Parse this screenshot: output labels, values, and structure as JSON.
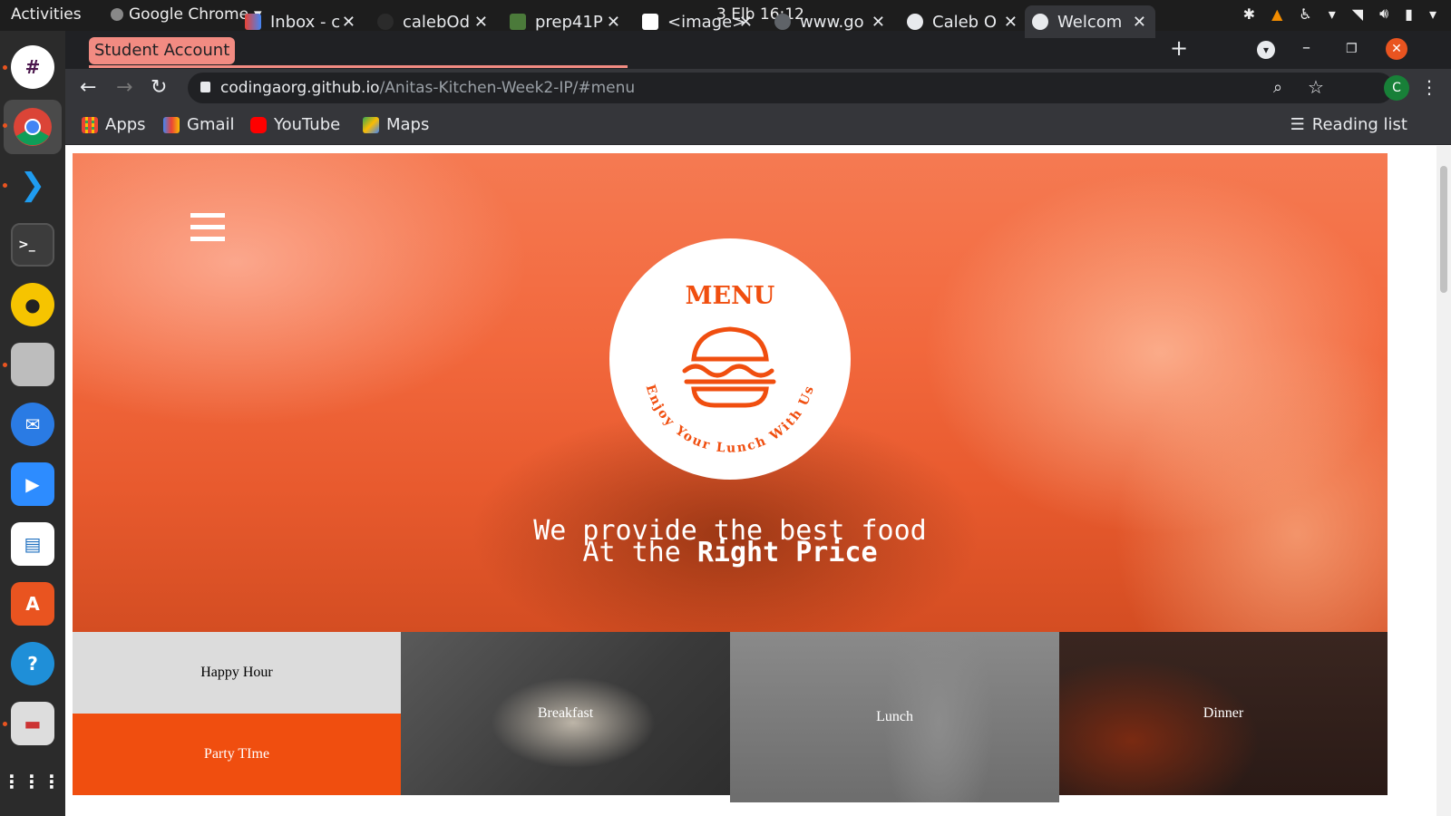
{
  "system": {
    "activities_label": "Activities",
    "app_name": "Google Chrome",
    "clock": "3 Elb  16:12"
  },
  "browser": {
    "tab_group_label": "Student Account",
    "tabs": [
      {
        "label": "Inbox - c"
      },
      {
        "label": "calebOd"
      },
      {
        "label": "prep41P"
      },
      {
        "label": "<image>"
      },
      {
        "label": "www.go"
      },
      {
        "label": "Caleb O"
      },
      {
        "label": "Welcom"
      }
    ],
    "new_tab_label": "+",
    "url_host": "codingaorg.github.io",
    "url_path": "/Anitas-Kitchen-Week2-IP/#menu",
    "profile_initial": "C",
    "bookmarks": [
      {
        "label": "Apps",
        "icon": "apps-grid-icon"
      },
      {
        "label": "Gmail",
        "icon": "gmail-icon"
      },
      {
        "label": "YouTube",
        "icon": "youtube-icon"
      },
      {
        "label": "Maps",
        "icon": "maps-icon"
      }
    ],
    "reading_list_label": "Reading list"
  },
  "page": {
    "badge_title": "MENU",
    "badge_arc_text": "Enjoy Your Lunch With Us",
    "tagline_line1": "We provide the best food",
    "tagline_line2_prefix": "At the ",
    "tagline_line2_bold": "Right Price",
    "tiles": {
      "happy_hour": "Happy Hour",
      "party_time": "Party TIme",
      "breakfast": "Breakfast",
      "lunch": "Lunch",
      "dinner": "Dinner"
    }
  },
  "colors": {
    "accent": "#f04e0f",
    "tab_group": "#f28b82"
  }
}
